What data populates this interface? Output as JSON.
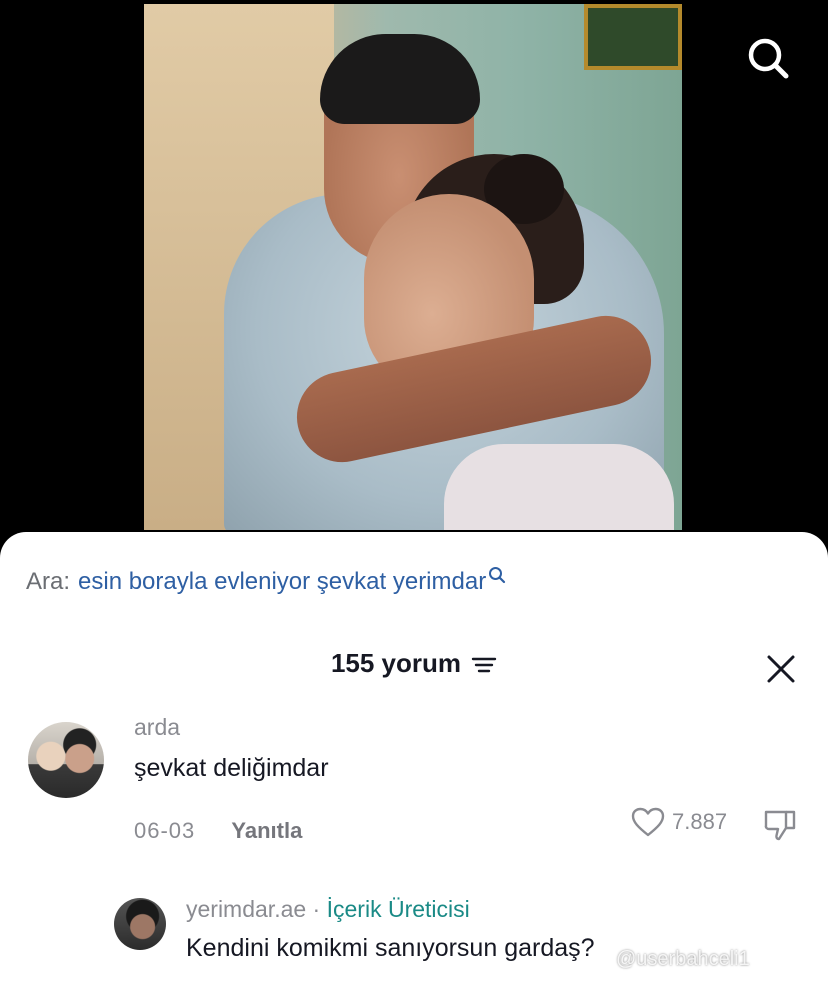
{
  "search_top": {
    "icon": "search-icon"
  },
  "suggest": {
    "prefix": "Ara:",
    "query": "esin borayla evleniyor şevkat yerimdar",
    "icon": "search-small-icon"
  },
  "header": {
    "count_label": "155 yorum",
    "sort_icon": "sort-icon",
    "close_icon": "close-icon"
  },
  "comments": [
    {
      "username": "arda",
      "text": "şevkat deliğimdar",
      "date": "06-03",
      "reply_label": "Yanıtla",
      "likes": "7.887"
    },
    {
      "username": "yerimdar.ae",
      "separator": " · ",
      "badge": "İçerik Üreticisi",
      "text": "Kendini komikmi sanıyorsun gardaş?"
    }
  ],
  "watermark": "@userbahceli1",
  "colors": {
    "link_blue": "#2e5fa3",
    "creator_teal": "#1a8a86",
    "muted": "#8a8b91",
    "text": "#161823"
  }
}
